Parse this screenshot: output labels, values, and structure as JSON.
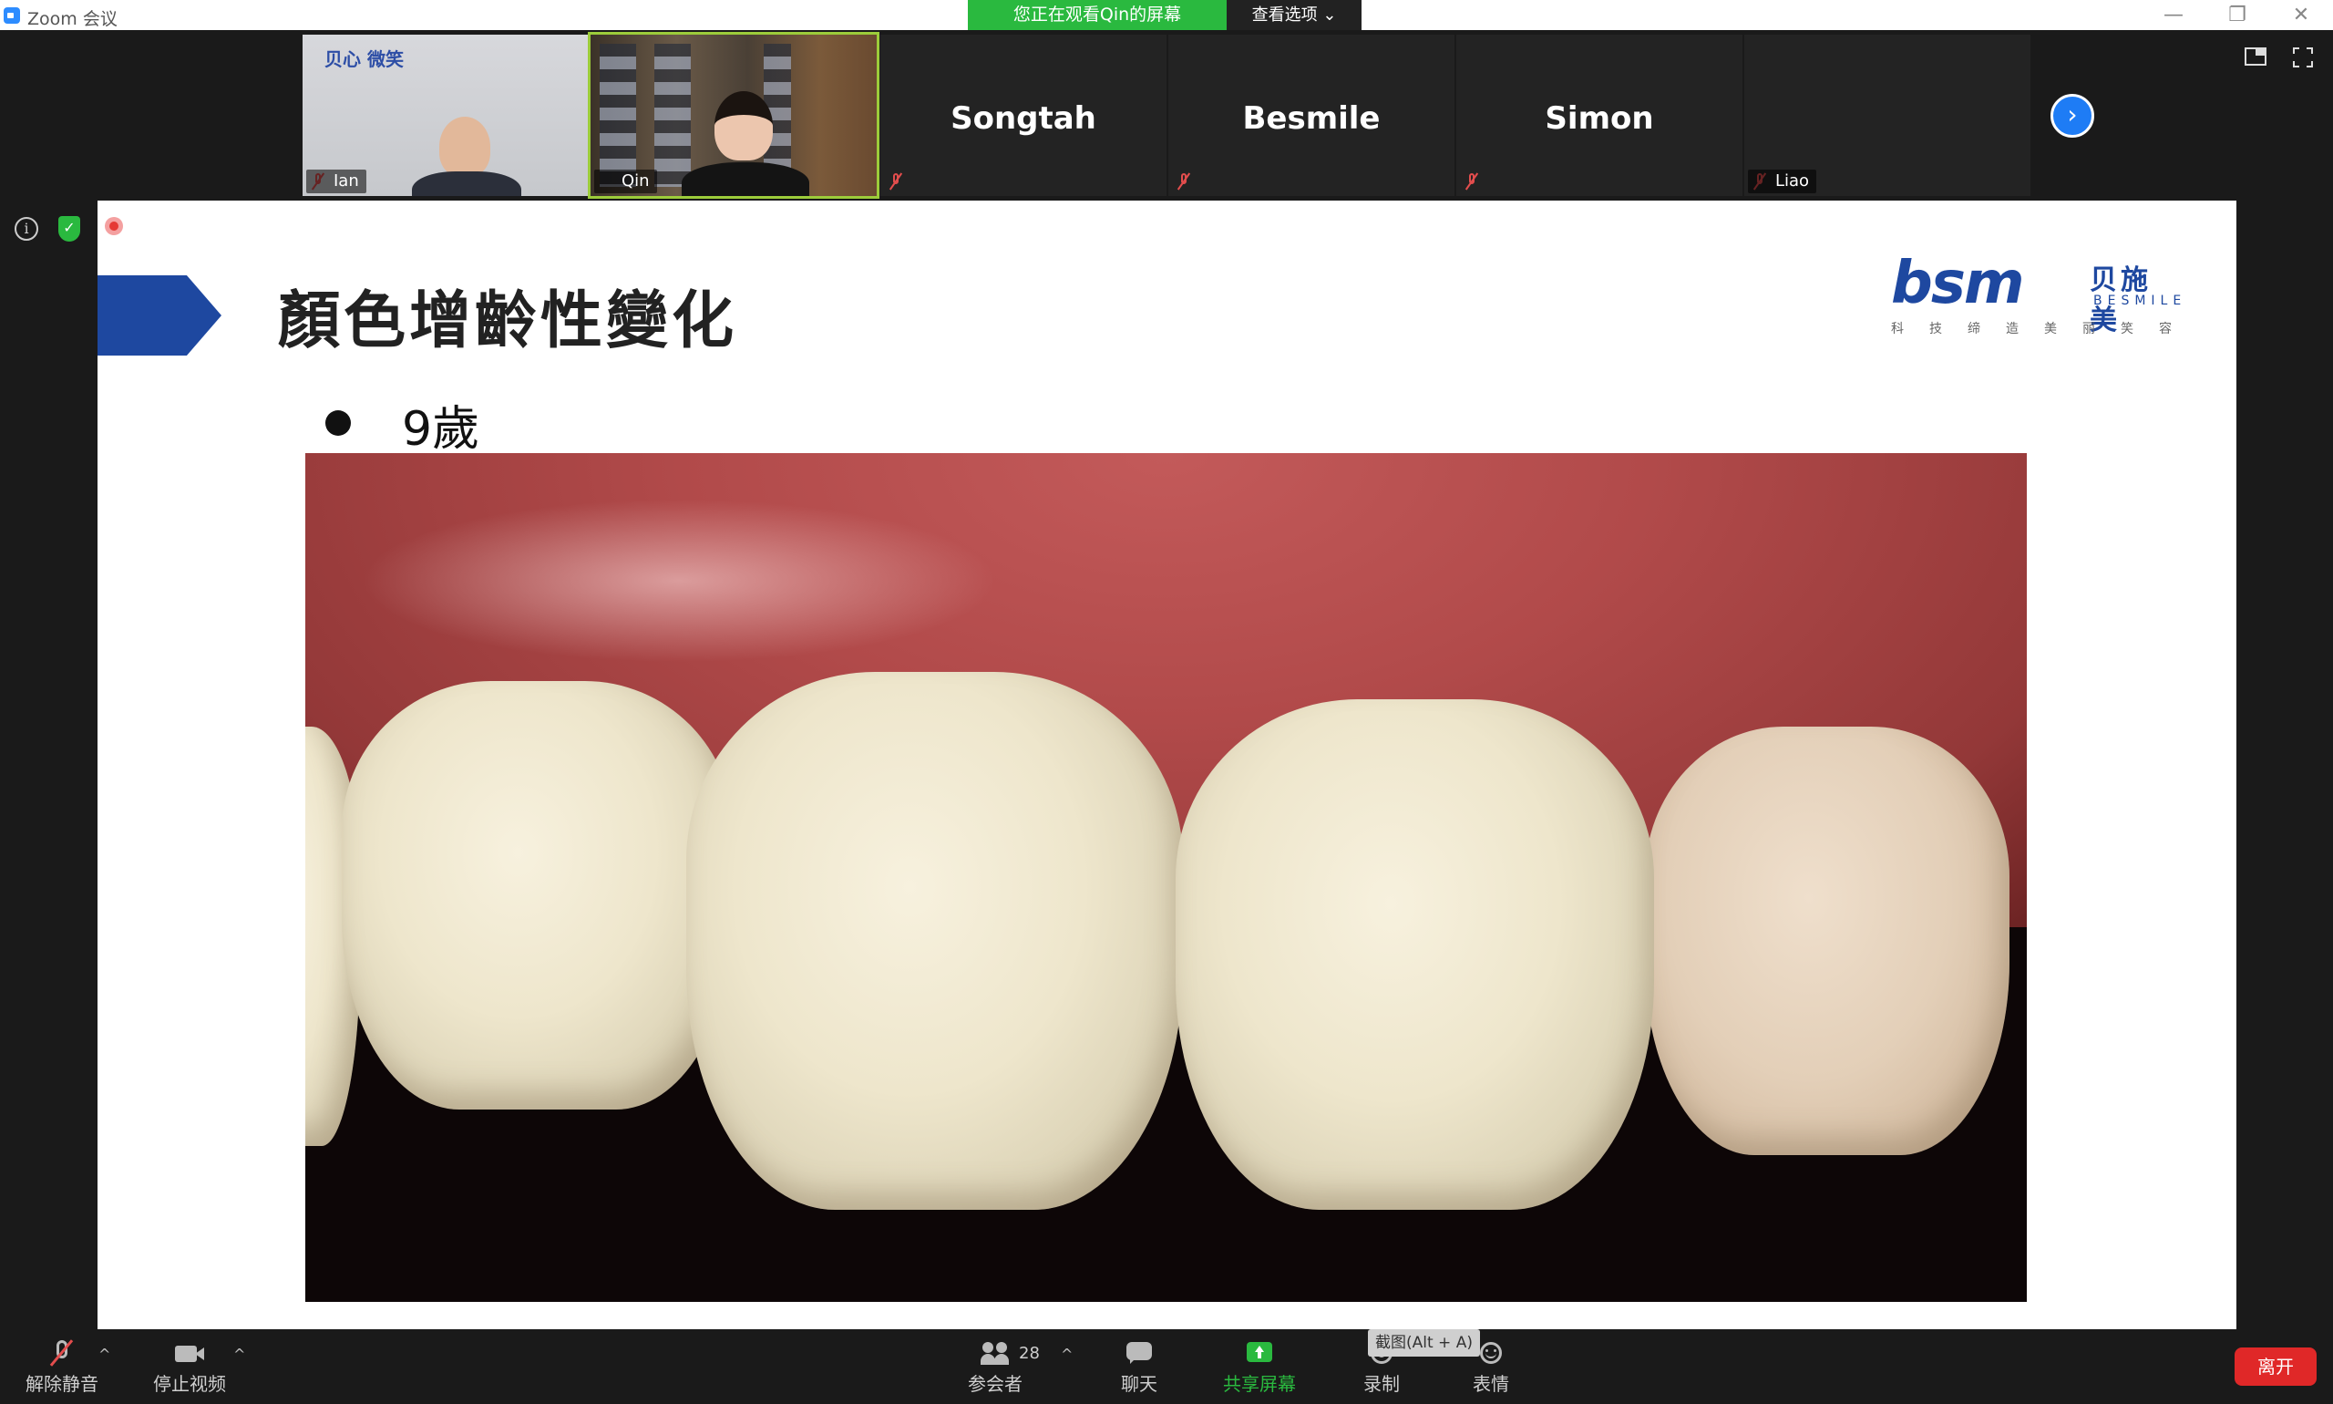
{
  "window": {
    "title": "Zoom 会议",
    "screen_banner": "您正在观看Qin的屏幕",
    "view_options": "查看选项 ⌄",
    "minimize": "—",
    "restore": "❐",
    "close": "✕"
  },
  "participants": [
    {
      "name": "Ian",
      "label": "Ian",
      "video": true
    },
    {
      "name": "Qin",
      "label": "Qin",
      "video": true,
      "active": true
    },
    {
      "name": "Songtah",
      "label": "",
      "video": false
    },
    {
      "name": "Besmile",
      "label": "",
      "video": false
    },
    {
      "name": "Simon",
      "label": "",
      "video": false
    },
    {
      "name": "Liao",
      "label": "Liao",
      "video": false
    }
  ],
  "slide": {
    "title": "顏色增齡性變化",
    "bullet": "9歲",
    "brand_mark": "bsm",
    "brand_cn": "贝施美",
    "brand_en": "BESMILE",
    "brand_tag": "科技缔造美丽笑容",
    "ian_logo_text": "贝心 微笑"
  },
  "toolbar": {
    "unmute": "解除静音",
    "stop_video": "停止视频",
    "participants": "参会者",
    "participant_count": "28",
    "chat": "聊天",
    "share_screen": "共享屏幕",
    "record": "录制",
    "reactions": "表情",
    "leave": "离开",
    "tooltip": "截图(Alt + A)",
    "caret": "^"
  },
  "colors": {
    "share_green": "#2ab93f",
    "leave_red": "#e02828",
    "brand_blue": "#1e48a0",
    "active_border": "#9ccc3a"
  }
}
